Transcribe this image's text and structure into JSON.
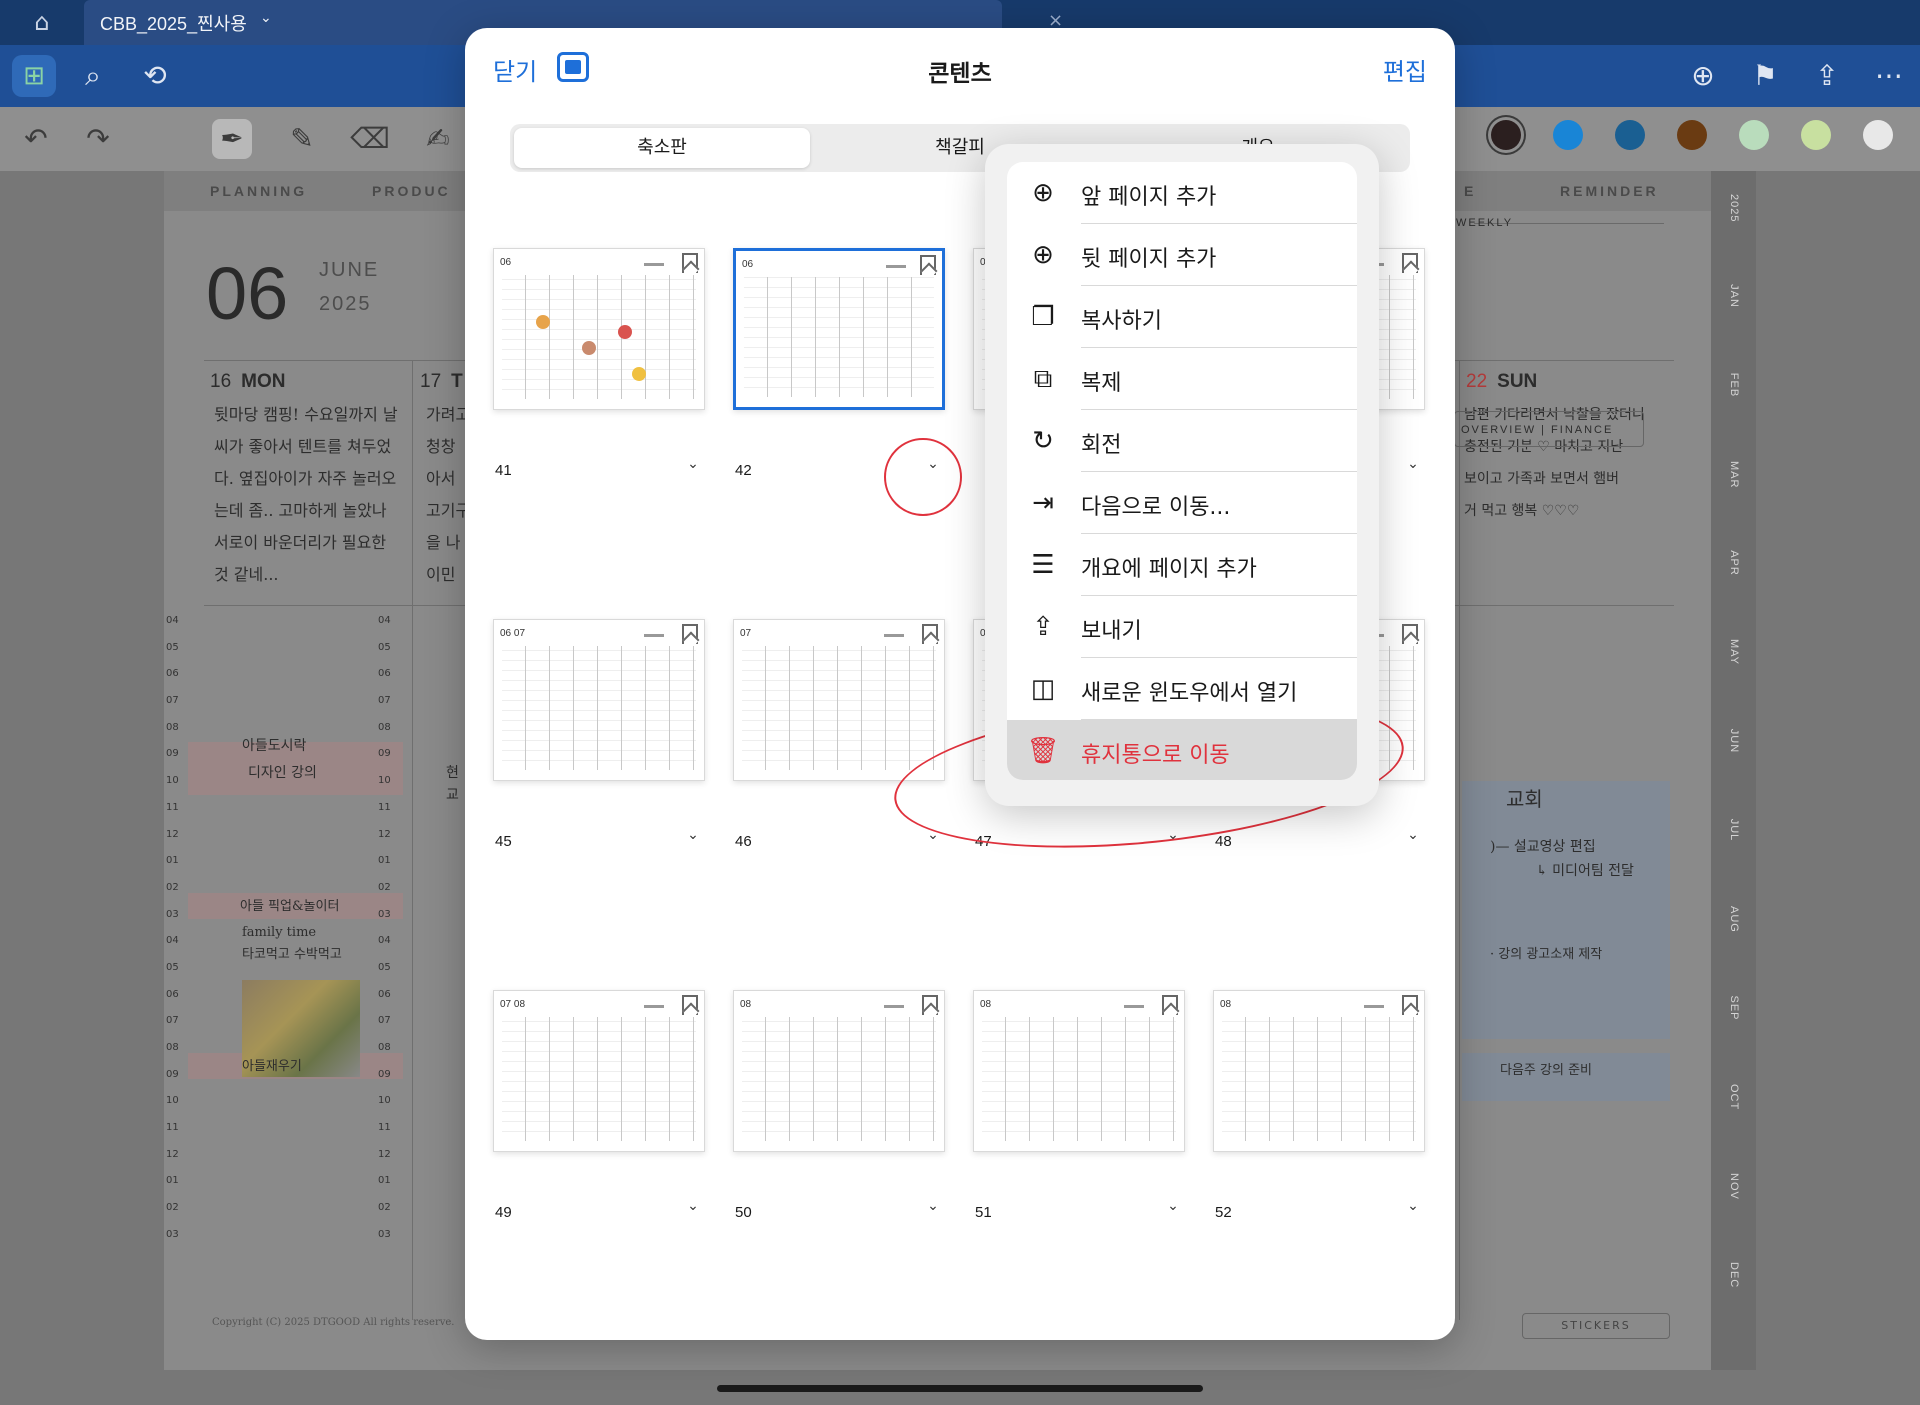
{
  "tabbar": {
    "home_icon": "home-icon",
    "doc_title": "CBB_2025_찐사용",
    "close_glyph": "×"
  },
  "toolbar": {
    "icons": [
      "grid-icon",
      "search-icon",
      "lasso-icon",
      "add-page-icon",
      "bookmark-icon",
      "share-icon",
      "more-icon"
    ]
  },
  "penbar": {
    "swatches": [
      "#7a5a3a",
      "#2b1f1f",
      "#1985d6",
      "#1a5f92",
      "#6a3b12",
      "#b9dcbc",
      "#c8e0a0",
      "#e8e8e8"
    ]
  },
  "planner": {
    "tabs": [
      "PLANNING",
      "PRODUC",
      "E",
      "REMINDER"
    ],
    "day": "06",
    "month": "JUNE",
    "year": "2025",
    "col_mon": {
      "d": "16",
      "name": "MON"
    },
    "col_tue": {
      "d": "17",
      "name": "T"
    },
    "col_sun": {
      "d": "22",
      "name": "SUN"
    },
    "weekly_label": "WEEKLY",
    "weekly_tabs": "OVERVIEW  |  FINANCE",
    "mon_note": [
      "뒷마당 캠핑! 수요일까지 날",
      "씨가 좋아서 텐트를 쳐두었",
      "다. 옆집아이가 자주 놀러오",
      "는데 좀.. 고마하게 놀았나",
      "서로이 바운더리가 필요한",
      "것 같네..."
    ],
    "tue_note": [
      "가려고",
      "청창",
      "아서",
      "고기구",
      "을 나",
      "이민"
    ],
    "sun_note": [
      "남편 기다리면서 낙찰을 잤더니",
      "충전된 기분 ♡ 마치고 지난",
      "보이고 가족과 보면서 햄버",
      "거 먹고 행복 ♡♡♡"
    ],
    "hours": [
      "04",
      "05",
      "06",
      "07",
      "08",
      "09",
      "10",
      "11",
      "12",
      "01",
      "02",
      "03",
      "04",
      "05",
      "06",
      "07",
      "08",
      "09",
      "10",
      "11",
      "12",
      "01",
      "02",
      "03"
    ],
    "mon_events": [
      "아들도시락",
      "디자인 강의",
      "아들 픽업&놀이터",
      "family time",
      "타코먹고 수박먹고",
      "아들재우기"
    ],
    "tue_events": [
      "현",
      "교"
    ],
    "sun_events": [
      "교회",
      ")— 설교영상 편집",
      "↳ 미디어팀 전달",
      "· 강의 광고소재 제작",
      "다음주 강의 준비"
    ],
    "rail_months": [
      "2025",
      "JAN",
      "FEB",
      "MAR",
      "APR",
      "MAY",
      "JUN",
      "JUL",
      "AUG",
      "SEP",
      "OCT",
      "NOV",
      "DEC"
    ],
    "copyright": "Copyright (C) 2025 DTGOOD All rights reserve.",
    "stickers": "STICKERS"
  },
  "sheet": {
    "close_label": "닫기",
    "title": "콘텐츠",
    "edit_label": "편집",
    "segments": [
      "축소판",
      "책갈피",
      "개요"
    ],
    "active_segment": 0,
    "pages": [
      {
        "num": "41",
        "date": "06"
      },
      {
        "num": "42",
        "date": "06",
        "selected": true
      },
      {
        "num": "",
        "date": "0"
      },
      {
        "num": "",
        "date": ""
      },
      {
        "num": "45",
        "date": "06 07"
      },
      {
        "num": "46",
        "date": "07"
      },
      {
        "num": "47",
        "date": "0"
      },
      {
        "num": "48",
        "date": ""
      },
      {
        "num": "49",
        "date": "07 08"
      },
      {
        "num": "50",
        "date": "08"
      },
      {
        "num": "51",
        "date": "08"
      },
      {
        "num": "52",
        "date": "08"
      }
    ]
  },
  "menu": {
    "items": [
      {
        "label": "앞 페이지 추가",
        "icon": "add-page-before-icon",
        "glyph": "⊕"
      },
      {
        "label": "뒷 페이지 추가",
        "icon": "add-page-after-icon",
        "glyph": "⊕"
      },
      {
        "label": "복사하기",
        "icon": "copy-icon",
        "glyph": "❐"
      },
      {
        "label": "복제",
        "icon": "duplicate-icon",
        "glyph": "⧉"
      },
      {
        "label": "회전",
        "icon": "rotate-icon",
        "glyph": "↻"
      },
      {
        "label": "다음으로 이동...",
        "icon": "move-to-icon",
        "glyph": "⇥"
      },
      {
        "label": "개요에 페이지 추가",
        "icon": "outline-list-icon",
        "glyph": "☰"
      },
      {
        "label": "보내기",
        "icon": "export-icon",
        "glyph": "⇪"
      },
      {
        "label": "새로운 윈도우에서 열기",
        "icon": "new-window-icon",
        "glyph": "◫"
      },
      {
        "label": "휴지통으로 이동",
        "icon": "trash-icon",
        "glyph": "🗑",
        "danger": true
      }
    ]
  },
  "colors": {
    "accent": "#1e6fd9",
    "danger": "#e0323d",
    "toolbar": "#1f4f96",
    "tabbar": "#173a6b"
  }
}
